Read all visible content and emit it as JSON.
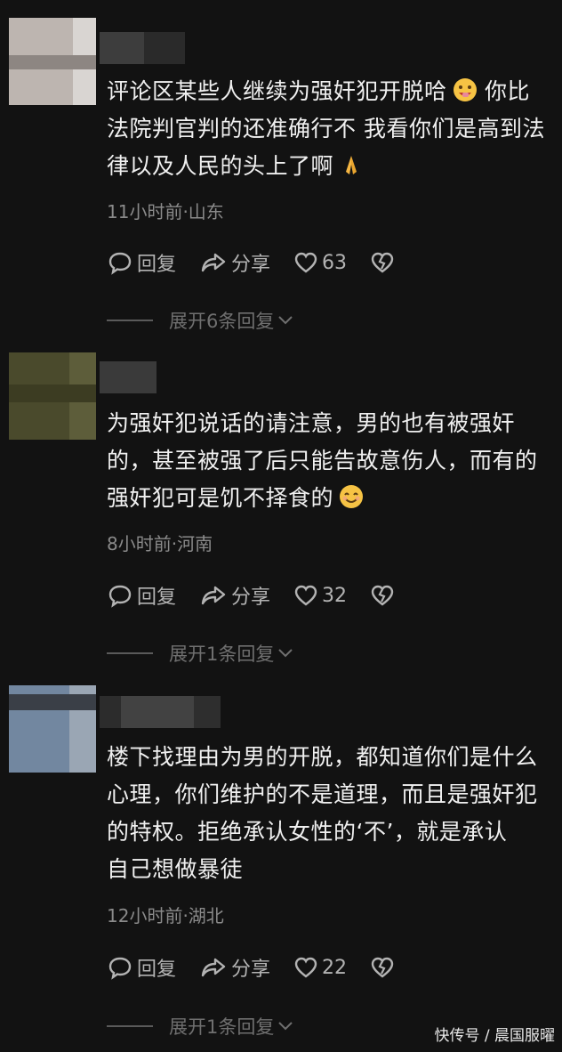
{
  "comments": [
    {
      "text": "评论区某些人继续为强奸犯开脱哈",
      "text_tail": " 你比\n法院判官判的还准确行不 我看你们是高到法\n律以及人民的头上了啊",
      "emoji_1": "money-mouth-face",
      "emoji_2": "folded-hands",
      "meta": "11小时前·山东",
      "reply_label": "回复",
      "share_label": "分享",
      "likes": "63",
      "expand_label": "展开6条回复"
    },
    {
      "text": "为强奸犯说话的请注意，男的也有被强奸\n的，甚至被强了后只能告故意伤人，而有的\n强奸犯可是饥不择食的",
      "emoji_1": "smiling-face",
      "meta": "8小时前·河南",
      "reply_label": "回复",
      "share_label": "分享",
      "likes": "32",
      "expand_label": "展开1条回复"
    },
    {
      "text": "楼下找理由为男的开脱，都知道你们是什么\n心理，你们维护的不是道理，而且是强奸犯\n的特权。拒绝承认女性的‘不’，就是承认\n自己想做暴徒",
      "meta": "12小时前·湖北",
      "reply_label": "回复",
      "share_label": "分享",
      "likes": "22",
      "expand_label": "展开1条回复"
    }
  ],
  "watermark": "快传号 / 晨国服曜",
  "colors": {
    "background": "#121212",
    "text": "#f0f0f0",
    "meta": "#8a8a8a",
    "action": "#b3b3b3",
    "expand": "#6f6f6f"
  }
}
